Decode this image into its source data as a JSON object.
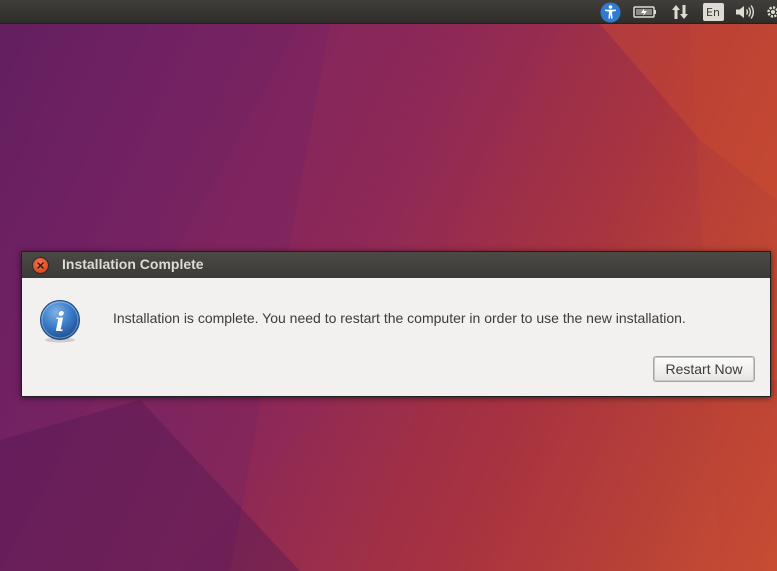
{
  "panel": {
    "tray_icons": [
      "accessibility-icon",
      "battery-icon",
      "network-icon",
      "keyboard-layout-indicator",
      "volume-icon",
      "settings-icon"
    ],
    "keyboard_layout": "En"
  },
  "dialog": {
    "title": "Installation Complete",
    "icon": "info-icon",
    "message": "Installation is complete. You need to restart the computer in order to use the new installation.",
    "restart_button": "Restart Now"
  },
  "colors": {
    "close_button": "#e2502a",
    "accessibility_icon": "#2e7bd0",
    "info_icon": "#2e6db4",
    "dialog_background": "#f2f1f0",
    "titlebar": "#3f3e3a"
  }
}
